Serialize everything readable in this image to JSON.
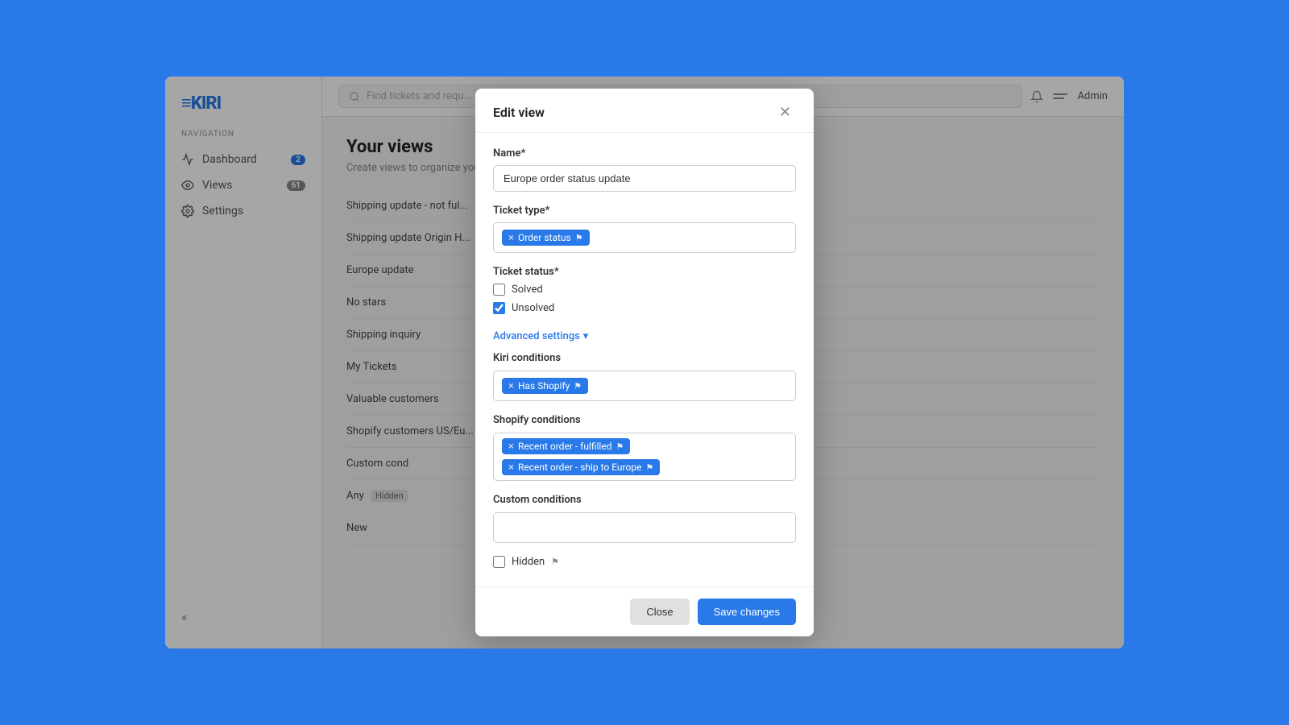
{
  "app": {
    "logo": "≡KIRI",
    "nav_label": "NAVIGATION"
  },
  "sidebar": {
    "items": [
      {
        "id": "dashboard",
        "label": "Dashboard",
        "badge": "2",
        "badge_color": "blue"
      },
      {
        "id": "views",
        "label": "Views",
        "badge": "61",
        "badge_color": "gray"
      },
      {
        "id": "settings",
        "label": "Settings",
        "badge": null
      }
    ],
    "collapse_label": "«"
  },
  "topbar": {
    "search_placeholder": "Find tickets and requ...",
    "admin_label": "Admin"
  },
  "page": {
    "title": "Your views",
    "subtitle": "Create views to organize you...",
    "views": [
      {
        "label": "Shipping update - not ful...",
        "hidden": false
      },
      {
        "label": "Shipping update Origin H...",
        "hidden": false
      },
      {
        "label": "Europe update",
        "hidden": false
      },
      {
        "label": "No stars",
        "hidden": false
      },
      {
        "label": "Shipping inquiry",
        "hidden": false
      },
      {
        "label": "My Tickets",
        "hidden": false
      },
      {
        "label": "Valuable customers",
        "hidden": false
      },
      {
        "label": "Shopify customers US/Eu...",
        "hidden": false
      },
      {
        "label": "Custom cond",
        "hidden": false
      },
      {
        "label": "Any",
        "hidden": true
      },
      {
        "label": "New",
        "hidden": false
      }
    ]
  },
  "modal": {
    "title": "Edit view",
    "name_label": "Name*",
    "name_value": "Europe order status update",
    "ticket_type_label": "Ticket type*",
    "ticket_type_tags": [
      {
        "label": "Order status",
        "removable": true
      }
    ],
    "ticket_status_label": "Ticket status*",
    "ticket_status_options": [
      {
        "label": "Solved",
        "checked": false
      },
      {
        "label": "Unsolved",
        "checked": true
      }
    ],
    "advanced_settings_label": "Advanced settings",
    "kiri_conditions_label": "Kiri conditions",
    "kiri_conditions_tags": [
      {
        "label": "Has Shopify",
        "removable": true
      }
    ],
    "shopify_conditions_label": "Shopify conditions",
    "shopify_conditions_tags": [
      {
        "label": "Recent order - fulfilled",
        "removable": true
      },
      {
        "label": "Recent order - ship to Europe",
        "removable": true
      }
    ],
    "custom_conditions_label": "Custom conditions",
    "custom_conditions_value": "",
    "hidden_label": "Hidden",
    "hidden_checked": false,
    "close_label": "Close",
    "save_label": "Save changes"
  }
}
